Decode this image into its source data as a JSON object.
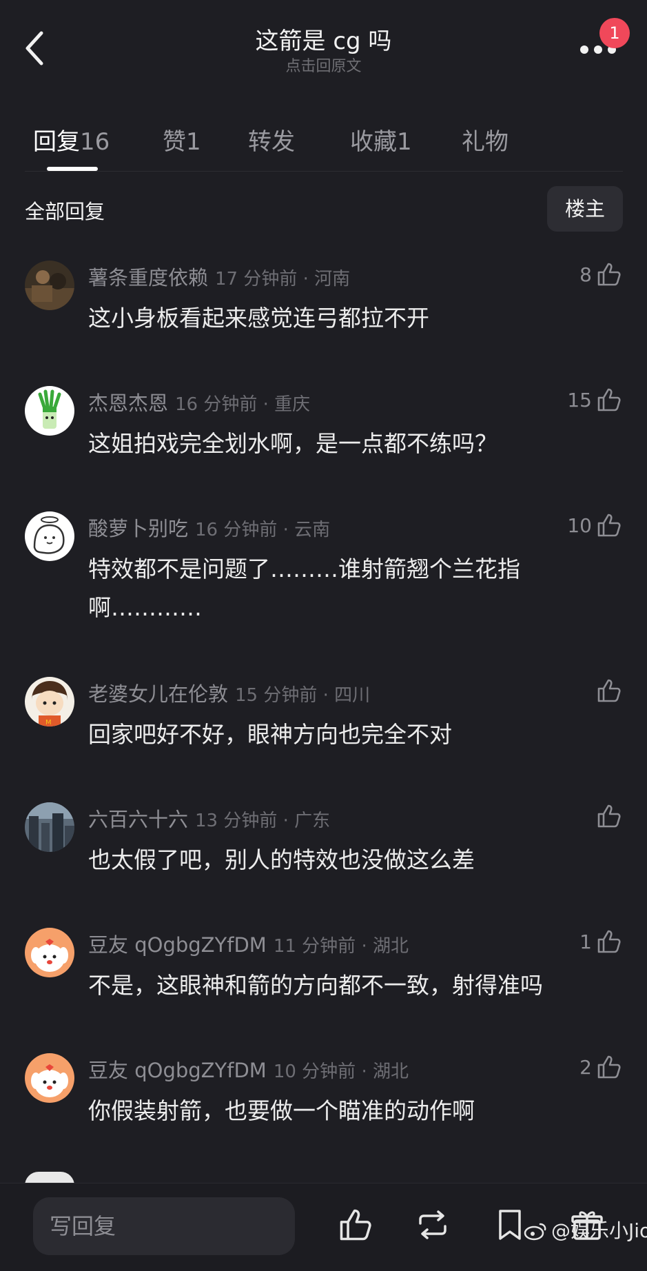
{
  "header": {
    "title": "这箭是 cg 吗",
    "subtitle": "点击回原文",
    "notification_count": "1"
  },
  "tabs": [
    {
      "label": "回复",
      "count": "16"
    },
    {
      "label": "赞",
      "count": "1"
    },
    {
      "label": "转发",
      "count": ""
    },
    {
      "label": "收藏",
      "count": "1"
    },
    {
      "label": "礼物",
      "count": ""
    }
  ],
  "section": {
    "title": "全部回复",
    "owner_button": "楼主"
  },
  "comments": [
    {
      "user": "薯条重度依赖",
      "time": "17 分钟前 · 河南",
      "text": "这小身板看起来感觉连弓都拉不开",
      "likes": "8",
      "avatar": "photo-avatar"
    },
    {
      "user": "杰恩杰恩",
      "time": "16 分钟前 · 重庆",
      "text": "这姐拍戏完全划水啊，是一点都不练吗？",
      "likes": "15",
      "avatar": "green-onion-avatar"
    },
    {
      "user": "酸萝卜别吃",
      "time": "16 分钟前 · 云南",
      "text": "特效都不是问题了………谁射箭翘个兰花指啊…………",
      "likes": "10",
      "avatar": "ghost-avatar"
    },
    {
      "user": "老婆女儿在伦敦",
      "time": "15 分钟前 · 四川",
      "text": "回家吧好不好，眼神方向也完全不对",
      "likes": "",
      "avatar": "cartoon-kid-avatar"
    },
    {
      "user": "六百六十六",
      "time": "13 分钟前 · 广东",
      "text": "也太假了吧，别人的特效也没做这么差",
      "likes": "",
      "avatar": "city-avatar"
    },
    {
      "user": "豆友 qOgbgZYfDM",
      "time": "11 分钟前 · 湖北",
      "text": "不是，这眼神和箭的方向都不一致，射得准吗",
      "likes": "1",
      "avatar": "dog-avatar"
    },
    {
      "user": "豆友 qOgbgZYfDM",
      "time": "10 分钟前 · 湖北",
      "text": "你假装射箭，也要做一个瞄准的动作啊",
      "likes": "2",
      "avatar": "dog-avatar"
    }
  ],
  "bottom_bar": {
    "reply_placeholder": "写回复",
    "icons": [
      "like-icon",
      "repost-icon",
      "bookmark-icon",
      "gift-icon"
    ]
  },
  "watermark": "@娱乐小Jio"
}
